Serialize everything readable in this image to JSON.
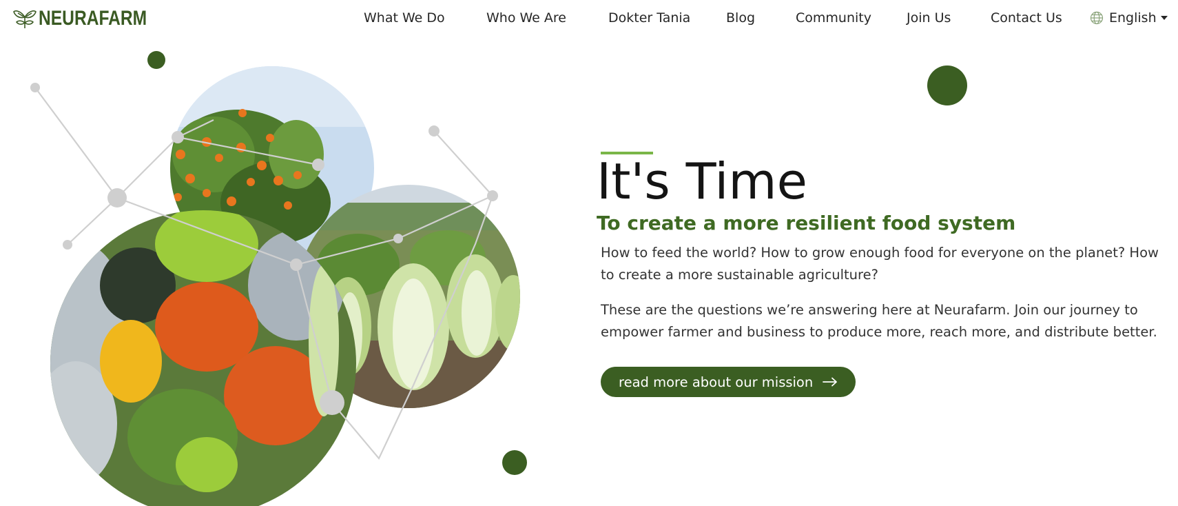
{
  "brand": {
    "name": "NEURAFARM",
    "color": "#3a5a23"
  },
  "nav": {
    "items": [
      {
        "label": "What We Do"
      },
      {
        "label": "Who We Are"
      },
      {
        "label": "Dokter Tania"
      },
      {
        "label": "Blog"
      },
      {
        "label": "Community"
      },
      {
        "label": "Join Us"
      },
      {
        "label": "Contact Us"
      }
    ],
    "language": {
      "label": "English",
      "icon": "globe-icon"
    }
  },
  "hero": {
    "title": "It's Time",
    "subtitle": "To create a more resilient food system",
    "paragraph_1": "How to feed the world? How to grow enough food for everyone on the planet? How to create a more sustainable agriculture?",
    "paragraph_2": "These are the questions we’re answering here at Neurafarm. Join our journey to empower farmer and business to produce more, reach more, and distribute better.",
    "cta_label": "read more about our mission",
    "cta_icon": "arrow-right-icon"
  },
  "colors": {
    "primary": "#3b5e22",
    "accent": "#7ab648",
    "subtitle": "#3f6a23"
  }
}
